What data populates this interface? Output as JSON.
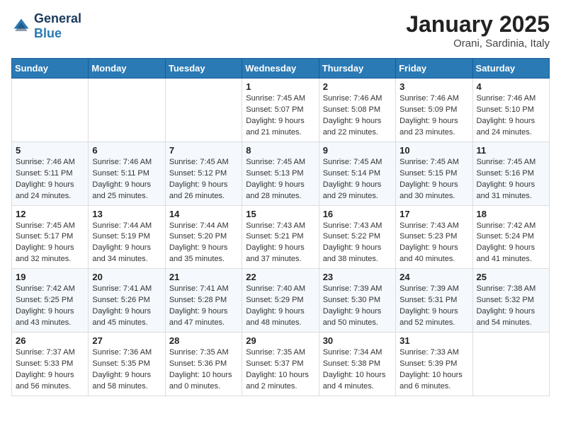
{
  "header": {
    "logo_general": "General",
    "logo_blue": "Blue",
    "month_year": "January 2025",
    "location": "Orani, Sardinia, Italy"
  },
  "weekdays": [
    "Sunday",
    "Monday",
    "Tuesday",
    "Wednesday",
    "Thursday",
    "Friday",
    "Saturday"
  ],
  "weeks": [
    [
      {
        "day": "",
        "info": ""
      },
      {
        "day": "",
        "info": ""
      },
      {
        "day": "",
        "info": ""
      },
      {
        "day": "1",
        "info": "Sunrise: 7:45 AM\nSunset: 5:07 PM\nDaylight: 9 hours\nand 21 minutes."
      },
      {
        "day": "2",
        "info": "Sunrise: 7:46 AM\nSunset: 5:08 PM\nDaylight: 9 hours\nand 22 minutes."
      },
      {
        "day": "3",
        "info": "Sunrise: 7:46 AM\nSunset: 5:09 PM\nDaylight: 9 hours\nand 23 minutes."
      },
      {
        "day": "4",
        "info": "Sunrise: 7:46 AM\nSunset: 5:10 PM\nDaylight: 9 hours\nand 24 minutes."
      }
    ],
    [
      {
        "day": "5",
        "info": "Sunrise: 7:46 AM\nSunset: 5:11 PM\nDaylight: 9 hours\nand 24 minutes."
      },
      {
        "day": "6",
        "info": "Sunrise: 7:46 AM\nSunset: 5:11 PM\nDaylight: 9 hours\nand 25 minutes."
      },
      {
        "day": "7",
        "info": "Sunrise: 7:45 AM\nSunset: 5:12 PM\nDaylight: 9 hours\nand 26 minutes."
      },
      {
        "day": "8",
        "info": "Sunrise: 7:45 AM\nSunset: 5:13 PM\nDaylight: 9 hours\nand 28 minutes."
      },
      {
        "day": "9",
        "info": "Sunrise: 7:45 AM\nSunset: 5:14 PM\nDaylight: 9 hours\nand 29 minutes."
      },
      {
        "day": "10",
        "info": "Sunrise: 7:45 AM\nSunset: 5:15 PM\nDaylight: 9 hours\nand 30 minutes."
      },
      {
        "day": "11",
        "info": "Sunrise: 7:45 AM\nSunset: 5:16 PM\nDaylight: 9 hours\nand 31 minutes."
      }
    ],
    [
      {
        "day": "12",
        "info": "Sunrise: 7:45 AM\nSunset: 5:17 PM\nDaylight: 9 hours\nand 32 minutes."
      },
      {
        "day": "13",
        "info": "Sunrise: 7:44 AM\nSunset: 5:19 PM\nDaylight: 9 hours\nand 34 minutes."
      },
      {
        "day": "14",
        "info": "Sunrise: 7:44 AM\nSunset: 5:20 PM\nDaylight: 9 hours\nand 35 minutes."
      },
      {
        "day": "15",
        "info": "Sunrise: 7:43 AM\nSunset: 5:21 PM\nDaylight: 9 hours\nand 37 minutes."
      },
      {
        "day": "16",
        "info": "Sunrise: 7:43 AM\nSunset: 5:22 PM\nDaylight: 9 hours\nand 38 minutes."
      },
      {
        "day": "17",
        "info": "Sunrise: 7:43 AM\nSunset: 5:23 PM\nDaylight: 9 hours\nand 40 minutes."
      },
      {
        "day": "18",
        "info": "Sunrise: 7:42 AM\nSunset: 5:24 PM\nDaylight: 9 hours\nand 41 minutes."
      }
    ],
    [
      {
        "day": "19",
        "info": "Sunrise: 7:42 AM\nSunset: 5:25 PM\nDaylight: 9 hours\nand 43 minutes."
      },
      {
        "day": "20",
        "info": "Sunrise: 7:41 AM\nSunset: 5:26 PM\nDaylight: 9 hours\nand 45 minutes."
      },
      {
        "day": "21",
        "info": "Sunrise: 7:41 AM\nSunset: 5:28 PM\nDaylight: 9 hours\nand 47 minutes."
      },
      {
        "day": "22",
        "info": "Sunrise: 7:40 AM\nSunset: 5:29 PM\nDaylight: 9 hours\nand 48 minutes."
      },
      {
        "day": "23",
        "info": "Sunrise: 7:39 AM\nSunset: 5:30 PM\nDaylight: 9 hours\nand 50 minutes."
      },
      {
        "day": "24",
        "info": "Sunrise: 7:39 AM\nSunset: 5:31 PM\nDaylight: 9 hours\nand 52 minutes."
      },
      {
        "day": "25",
        "info": "Sunrise: 7:38 AM\nSunset: 5:32 PM\nDaylight: 9 hours\nand 54 minutes."
      }
    ],
    [
      {
        "day": "26",
        "info": "Sunrise: 7:37 AM\nSunset: 5:33 PM\nDaylight: 9 hours\nand 56 minutes."
      },
      {
        "day": "27",
        "info": "Sunrise: 7:36 AM\nSunset: 5:35 PM\nDaylight: 9 hours\nand 58 minutes."
      },
      {
        "day": "28",
        "info": "Sunrise: 7:35 AM\nSunset: 5:36 PM\nDaylight: 10 hours\nand 0 minutes."
      },
      {
        "day": "29",
        "info": "Sunrise: 7:35 AM\nSunset: 5:37 PM\nDaylight: 10 hours\nand 2 minutes."
      },
      {
        "day": "30",
        "info": "Sunrise: 7:34 AM\nSunset: 5:38 PM\nDaylight: 10 hours\nand 4 minutes."
      },
      {
        "day": "31",
        "info": "Sunrise: 7:33 AM\nSunset: 5:39 PM\nDaylight: 10 hours\nand 6 minutes."
      },
      {
        "day": "",
        "info": ""
      }
    ]
  ]
}
